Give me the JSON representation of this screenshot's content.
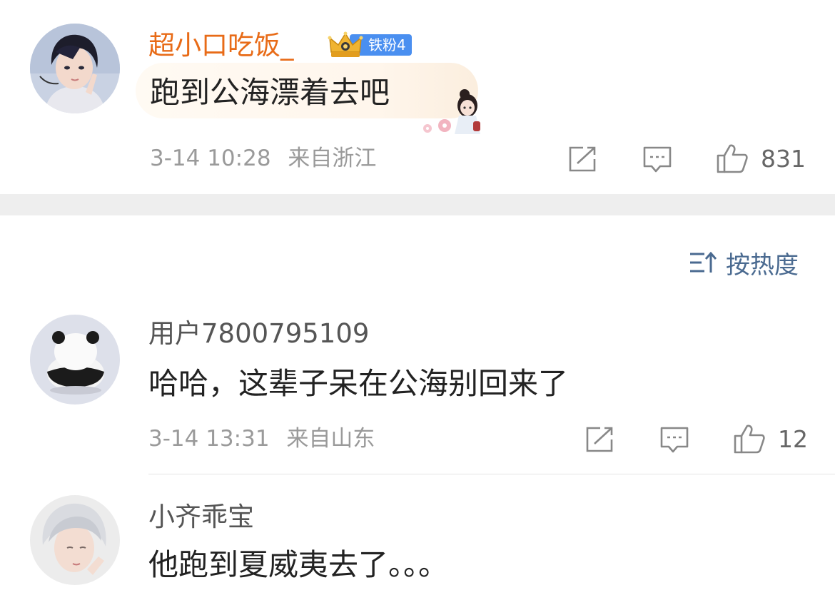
{
  "comments": [
    {
      "username": "超小口吃饭_",
      "badge": "铁粉4",
      "text": "跑到公海漂着去吧",
      "time": "3-14 10:28",
      "location": "来自浙江",
      "likes": "831",
      "icons": [
        "forward-icon",
        "comment-icon",
        "like-icon"
      ]
    },
    {
      "username": "用户7800795109",
      "text": "哈哈，这辈子呆在公海别回来了",
      "time": "3-14 13:31",
      "location": "来自山东",
      "likes": "12",
      "icons": [
        "forward-icon",
        "comment-icon",
        "like-icon"
      ]
    },
    {
      "username": "小齐乖宝",
      "text": "他跑到夏威夷去了。。。"
    }
  ],
  "sort": {
    "label": "按热度",
    "icon": "sort-icon"
  },
  "colors": {
    "vip_name": "#e86b17",
    "badge_bg": "#4a8ff0",
    "sort_text": "#4a6a90",
    "meta_text": "#9a9a9a"
  }
}
